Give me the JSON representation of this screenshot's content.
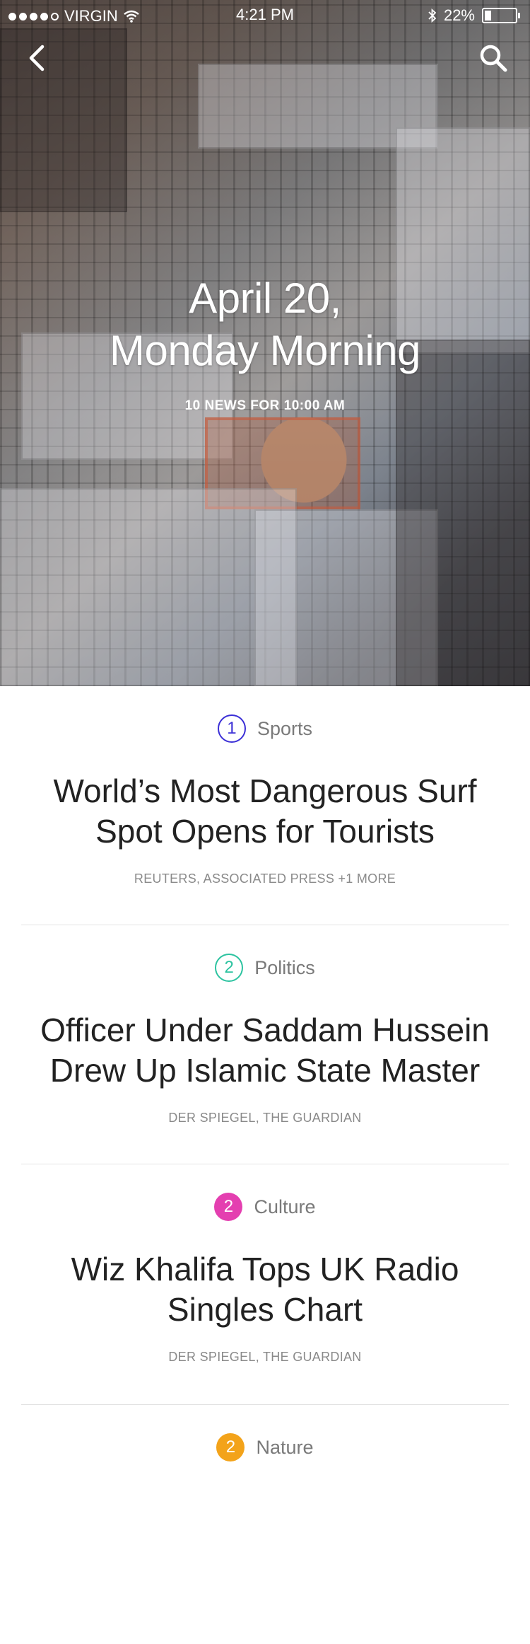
{
  "status_bar": {
    "carrier": "VIRGIN",
    "time": "4:21 PM",
    "battery": "22%",
    "battery_level": 0.22
  },
  "nav": {
    "back_icon": "chevron-left-icon",
    "search_icon": "search-icon"
  },
  "hero": {
    "title_line1": "April 20,",
    "title_line2": "Monday Morning",
    "subtitle": "10 NEWS FOR 10:00 AM"
  },
  "news": [
    {
      "number": "1",
      "category": "Sports",
      "headline": "World’s Most Dangerous Surf Spot Opens for Tourists",
      "sources": "REUTERS, ASSOCIATED PRESS +1 MORE",
      "badge_color": "#3b2fd6",
      "badge_style": "outline"
    },
    {
      "number": "2",
      "category": "Politics",
      "headline": "Officer Under Saddam Hussein Drew Up Islamic State Master",
      "sources": "DER SPIEGEL, THE GUARDIAN",
      "badge_color": "#2cc3a0",
      "badge_style": "outline"
    },
    {
      "number": "2",
      "category": "Culture",
      "headline": "Wiz Khalifa Tops UK Radio Singles Chart",
      "sources": "DER SPIEGEL, THE GUARDIAN",
      "badge_color": "#e43fb0",
      "badge_style": "filled"
    },
    {
      "number": "2",
      "category": "Nature",
      "headline": "",
      "sources": "",
      "badge_color": "#f3a31a",
      "badge_style": "filled"
    }
  ]
}
